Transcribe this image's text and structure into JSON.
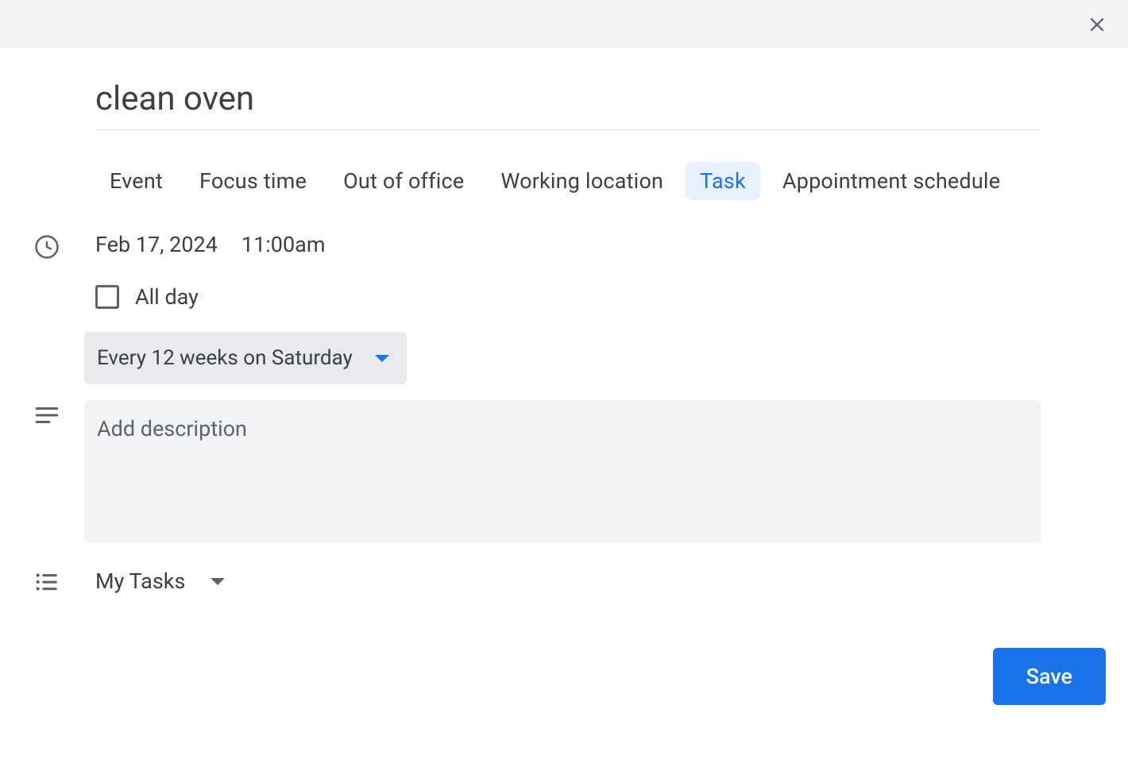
{
  "title": "clean oven",
  "tabs": [
    {
      "label": "Event"
    },
    {
      "label": "Focus time"
    },
    {
      "label": "Out of office"
    },
    {
      "label": "Working location"
    },
    {
      "label": "Task",
      "active": true
    },
    {
      "label": "Appointment schedule"
    }
  ],
  "date": "Feb 17, 2024",
  "time": "11:00am",
  "allday_label": "All day",
  "allday_checked": false,
  "recurrence": "Every 12 weeks on Saturday",
  "description_placeholder": "Add description",
  "tasklist": "My Tasks",
  "save_label": "Save"
}
